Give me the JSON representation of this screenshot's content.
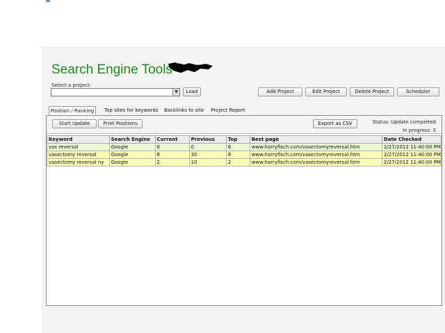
{
  "app": {
    "title": "Search Engine Tools"
  },
  "project": {
    "select_label": "Select a project:",
    "selected_value": "",
    "load_label": "Load"
  },
  "actions": {
    "add_project": "Add Project",
    "edit_project": "Edit Project",
    "delete_project": "Delete Project",
    "scheduler": "Scheduler"
  },
  "tabs": [
    {
      "label": "Position / Ranking",
      "active": true
    },
    {
      "label": "Top sites for keywords",
      "active": false
    },
    {
      "label": "Backlinks to site",
      "active": false
    },
    {
      "label": "Project Report",
      "active": false
    }
  ],
  "toolbar": {
    "start_update": "Start Update",
    "print_positions": "Print Positions",
    "export_csv": "Export as CSV",
    "status_text": "Status: Update completed",
    "in_progress_text": "In progress: 0"
  },
  "table": {
    "columns": [
      "Keyword",
      "Search Engine",
      "Current",
      "Previous",
      "Top",
      "Best page",
      "Date Checked"
    ],
    "rows": [
      [
        "vas reversal",
        "Google",
        "6",
        "0",
        "6",
        "www.harryfisch.com/vasectomyreversal.htm",
        "2/27/2012 11:40:00 PM"
      ],
      [
        "vasectomy reversal",
        "Google",
        "8",
        "30",
        "8",
        "www.harryfisch.com/vasectomyreversal.htm",
        "2/27/2012 11:40:00 PM"
      ],
      [
        "vasectomy reversal ny",
        "Google",
        "2",
        "10",
        "2",
        "www.harryfisch.com/vasectomyreversal.htm",
        "2/27/2012 11:40:00 PM"
      ]
    ]
  },
  "colors": {
    "title_green": "#1d8a1d",
    "row_green": "#e9f8d2",
    "row_yellow": "#fbfbb7"
  }
}
